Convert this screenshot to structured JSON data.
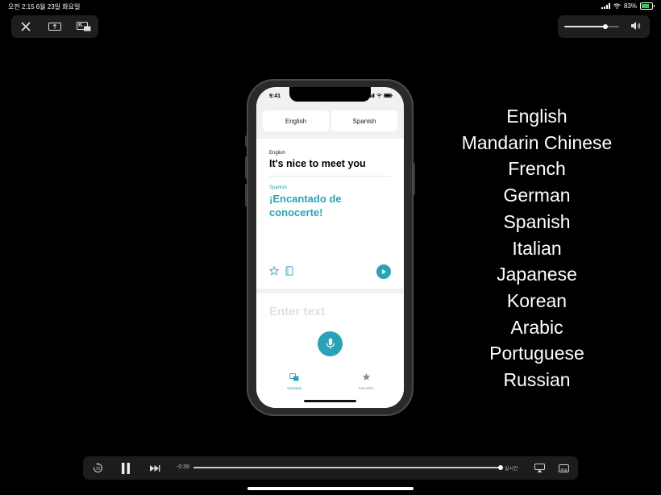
{
  "status_bar": {
    "time_date": "오전 2:15   6월 23일 화요일",
    "battery": "83%"
  },
  "player": {
    "elapsed": "-0:39",
    "live_label": "실시간",
    "progress": 1.0,
    "volume": 0.75
  },
  "phone": {
    "time": "9:41",
    "source_lang_button": "English",
    "target_lang_button": "Spanish",
    "source_label": "English",
    "source_text": "It's nice to meet you",
    "target_label": "Spanish",
    "target_text": "¡Encantado de conocerte!",
    "input_placeholder": "Enter text",
    "tabs": [
      {
        "label": "Translate"
      },
      {
        "label": "Favorites"
      }
    ]
  },
  "languages": [
    "English",
    "Mandarin Chinese",
    "French",
    "German",
    "Spanish",
    "Italian",
    "Japanese",
    "Korean",
    "Arabic",
    "Portuguese",
    "Russian"
  ],
  "colors": {
    "accent": "#2aa3b9",
    "background": "#000000",
    "battery": "#34c759"
  }
}
